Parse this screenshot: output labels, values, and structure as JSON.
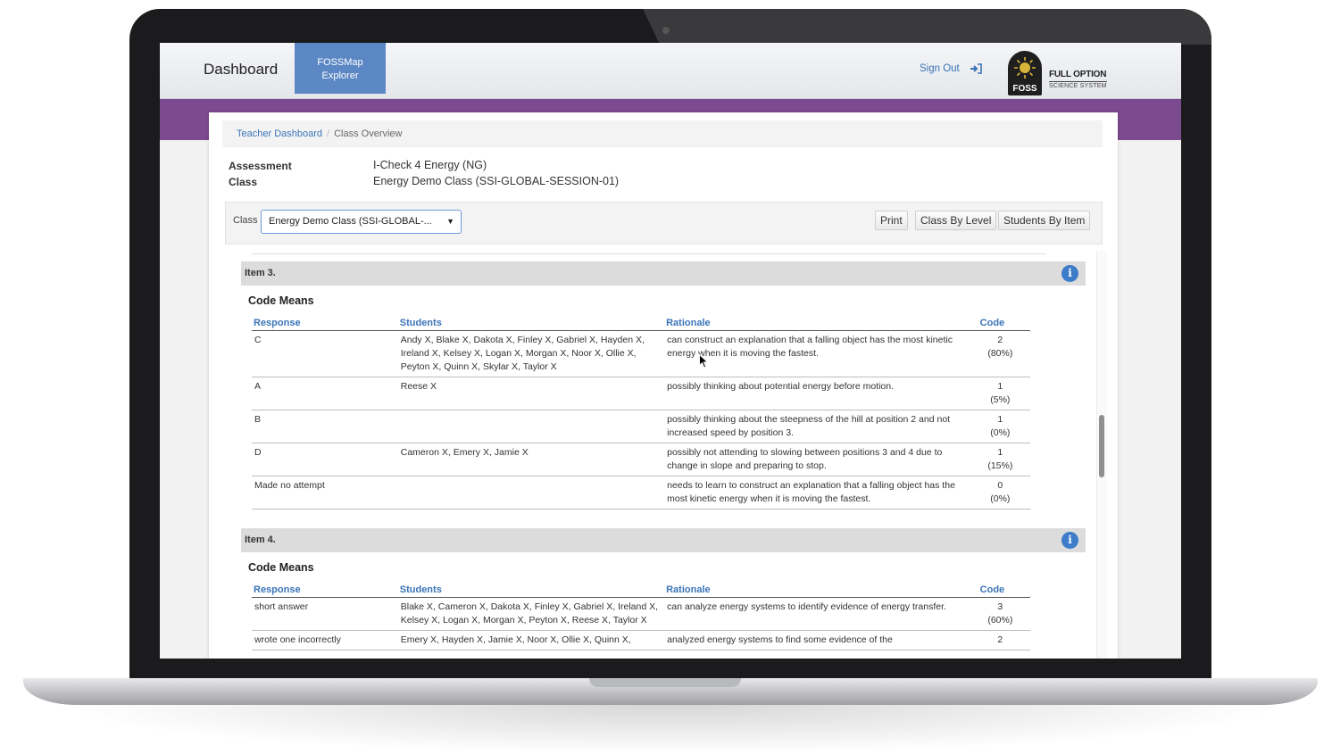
{
  "nav": {
    "brand": "Dashboard",
    "tab_fossmap_line1": "FOSSMap",
    "tab_fossmap_line2": "Explorer",
    "sign_out": "Sign Out",
    "logo_badge": "FOSS",
    "logo_title": "FULL OPTION",
    "logo_subtitle": "SCIENCE SYSTEM"
  },
  "breadcrumb": {
    "home": "Teacher Dashboard",
    "separator": "/",
    "current": "Class Overview"
  },
  "meta": {
    "assessment_label": "Assessment",
    "assessment_value": "I-Check 4 Energy (NG)",
    "class_label": "Class",
    "class_value": "Energy Demo Class (SSI-GLOBAL-SESSION-01)"
  },
  "filter": {
    "class_label": "Class",
    "class_selected": "Energy Demo Class (SSI-GLOBAL-...",
    "print": "Print",
    "class_by_level": "Class By Level",
    "students_by_item": "Students By Item"
  },
  "columns": {
    "response": "Response",
    "students": "Students",
    "rationale": "Rationale",
    "code": "Code"
  },
  "items": [
    {
      "title": "Item 3.",
      "section": "Code Means",
      "rows": [
        {
          "response": "C",
          "students": "Andy X, Blake X, Dakota X, Finley X, Gabriel X, Hayden X, Ireland X, Kelsey X, Logan X, Morgan X, Noor X, Ollie X, Peyton X, Quinn X, Skylar X, Taylor X",
          "rationale": "can construct an explanation that a falling object has the most kinetic energy when it is moving the fastest.",
          "code": "2",
          "pct": "(80%)"
        },
        {
          "response": "A",
          "students": "Reese X",
          "rationale": "possibly thinking about potential energy before motion.",
          "code": "1",
          "pct": "(5%)"
        },
        {
          "response": "B",
          "students": "",
          "rationale": "possibly thinking about the steepness of the hill at position 2 and not increased speed by position 3.",
          "code": "1",
          "pct": "(0%)"
        },
        {
          "response": "D",
          "students": "Cameron X, Emery X, Jamie X",
          "rationale": "possibly not attending to slowing between positions 3 and 4 due to change in slope and preparing to stop.",
          "code": "1",
          "pct": "(15%)"
        },
        {
          "response": "Made no attempt",
          "students": "",
          "rationale": "needs to learn to construct an explanation that a falling object has the most kinetic energy when it is moving the fastest.",
          "code": "0",
          "pct": "(0%)"
        }
      ]
    },
    {
      "title": "Item 4.",
      "section": "Code Means",
      "rows": [
        {
          "response": "short answer",
          "students": "Blake X, Cameron X, Dakota X, Finley X, Gabriel X, Ireland X, Kelsey X, Logan X, Morgan X, Peyton X, Reese X, Taylor X",
          "rationale": "can analyze energy systems to identify evidence of energy transfer.",
          "code": "3",
          "pct": "(60%)"
        },
        {
          "response": "wrote one incorrectly",
          "students": "Emery X, Hayden X, Jamie X, Noor X, Ollie X, Quinn X,",
          "rationale": "analyzed energy systems to find some evidence of the",
          "code": "2",
          "pct": ""
        }
      ]
    }
  ],
  "colors": {
    "accent_blue": "#3a74b8",
    "tab_blue": "#5b87c4",
    "band_purple": "#7c4a8e",
    "info_icon": "#3d7cc9"
  }
}
